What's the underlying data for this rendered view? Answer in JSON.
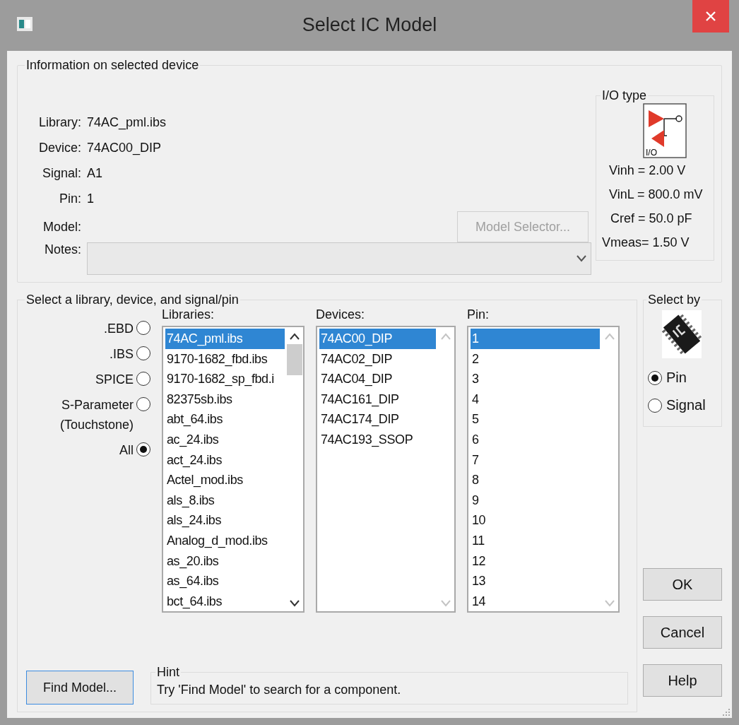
{
  "window": {
    "title": "Select IC Model"
  },
  "info_section": {
    "title": "Information on selected device",
    "fields": [
      {
        "label": "Library:",
        "value": "74AC_pml.ibs"
      },
      {
        "label": "Device:",
        "value": "74AC00_DIP"
      },
      {
        "label": "Signal:",
        "value": "A1"
      },
      {
        "label": "Pin:",
        "value": "1"
      },
      {
        "label": "Model:"
      }
    ],
    "model_selector_button": {
      "label": "Model Selector...",
      "disabled": true
    },
    "notes": {
      "label": "Notes:"
    },
    "io_type": {
      "title": "I/O type",
      "icon_label": "I/O",
      "readings": [
        "Vinh = 2.00 V",
        "VinL = 800.0 mV",
        "Cref = 50.0 pF",
        "Vmeas= 1.50 V"
      ]
    }
  },
  "select_section": {
    "title": "Select a library, device, and signal/pin",
    "source_options": [
      {
        "label": ".EBD",
        "selected": false
      },
      {
        "label": ".IBS",
        "selected": false
      },
      {
        "label": "SPICE",
        "selected": false
      },
      {
        "label": "S-Parameter (Touchstone)",
        "selected": false
      },
      {
        "label": "All",
        "selected": true
      }
    ],
    "lists": [
      {
        "label": "Libraries:",
        "scrollable": true,
        "items": [
          {
            "label": "74AC_pml.ibs",
            "selected": true
          },
          {
            "label": "9170-1682_fbd.ibs",
            "selected": false
          },
          {
            "label": "9170-1682_sp_fbd.i",
            "selected": false
          },
          {
            "label": "82375sb.ibs",
            "selected": false
          },
          {
            "label": "abt_64.ibs",
            "selected": false
          },
          {
            "label": "ac_24.ibs",
            "selected": false
          },
          {
            "label": "act_24.ibs",
            "selected": false
          },
          {
            "label": "Actel_mod.ibs",
            "selected": false
          },
          {
            "label": "als_8.ibs",
            "selected": false
          },
          {
            "label": "als_24.ibs",
            "selected": false
          },
          {
            "label": "Analog_d_mod.ibs",
            "selected": false
          },
          {
            "label": "as_20.ibs",
            "selected": false
          },
          {
            "label": "as_64.ibs",
            "selected": false
          },
          {
            "label": "bct_64.ibs",
            "selected": false
          }
        ]
      },
      {
        "label": "Devices:",
        "scrollable": false,
        "items": [
          {
            "label": "74AC00_DIP",
            "selected": true
          },
          {
            "label": "74AC02_DIP",
            "selected": false
          },
          {
            "label": "74AC04_DIP",
            "selected": false
          },
          {
            "label": "74AC161_DIP",
            "selected": false
          },
          {
            "label": "74AC174_DIP",
            "selected": false
          },
          {
            "label": "74AC193_SSOP",
            "selected": false
          }
        ]
      },
      {
        "label": "Pin:",
        "scrollable": false,
        "items": [
          {
            "label": "1",
            "selected": true
          },
          {
            "label": "2",
            "selected": false
          },
          {
            "label": "3",
            "selected": false
          },
          {
            "label": "4",
            "selected": false
          },
          {
            "label": "5",
            "selected": false
          },
          {
            "label": "6",
            "selected": false
          },
          {
            "label": "7",
            "selected": false
          },
          {
            "label": "8",
            "selected": false
          },
          {
            "label": "9",
            "selected": false
          },
          {
            "label": "10",
            "selected": false
          },
          {
            "label": "11",
            "selected": false
          },
          {
            "label": "12",
            "selected": false
          },
          {
            "label": "13",
            "selected": false
          },
          {
            "label": "14",
            "selected": false
          }
        ]
      }
    ],
    "find_model_button": {
      "label": "Find Model..."
    },
    "hint": {
      "title": "Hint",
      "text": "Try 'Find Model' to search for a component."
    }
  },
  "select_by": {
    "title": "Select by",
    "options": [
      {
        "label": "Pin",
        "selected": true
      },
      {
        "label": "Signal",
        "selected": false
      }
    ]
  },
  "buttons": [
    "OK",
    "Cancel",
    "Help"
  ]
}
